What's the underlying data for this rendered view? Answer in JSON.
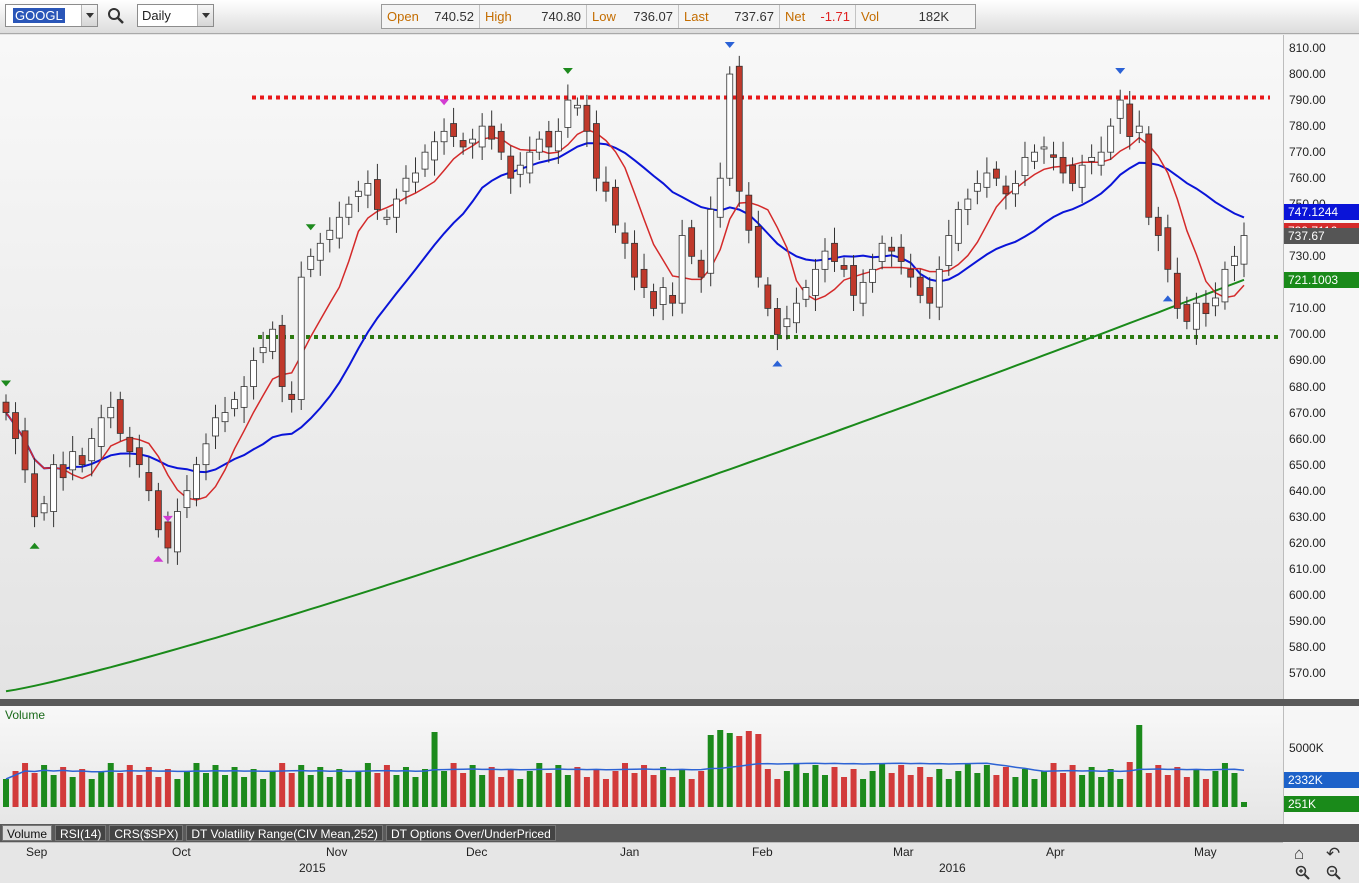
{
  "toolbar": {
    "symbol": "GOOGL",
    "interval": "Daily",
    "quote": [
      {
        "label": "Open",
        "value": "740.52",
        "color": "#333333"
      },
      {
        "label": "High",
        "value": "740.80",
        "color": "#333333"
      },
      {
        "label": "Low",
        "value": "736.07",
        "color": "#333333"
      },
      {
        "label": "Last",
        "value": "737.67",
        "color": "#333333"
      },
      {
        "label": "Net",
        "value": "-1.71",
        "color": "#e02020"
      },
      {
        "label": "Vol",
        "value": "182K",
        "color": "#333333"
      }
    ]
  },
  "price_axis": {
    "ticks": [
      "810.00",
      "800.00",
      "790.00",
      "780.00",
      "770.00",
      "760.00",
      "750.00",
      "740.00",
      "730.00",
      "720.00",
      "710.00",
      "700.00",
      "690.00",
      "680.00",
      "670.00",
      "660.00",
      "650.00",
      "640.00",
      "630.00",
      "620.00",
      "610.00",
      "600.00",
      "590.00",
      "580.00",
      "570.00"
    ],
    "tags": [
      {
        "text": "747.1244",
        "color": "#0a14d8",
        "value": 747.12
      },
      {
        "text": "739.7116",
        "color": "#d42a2a",
        "value": 739.71
      },
      {
        "text": "737.67",
        "color": "#555555",
        "value": 737.67
      },
      {
        "text": "721.1003",
        "color": "#1a8a1a",
        "value": 721.1
      }
    ]
  },
  "volume": {
    "title": "Volume",
    "tags": [
      {
        "text": "5000K",
        "kind": "tick"
      },
      {
        "text": "2332K",
        "color": "#1d62c9"
      },
      {
        "text": "251K",
        "color": "#1a8a1a"
      }
    ]
  },
  "tabs": [
    "Volume",
    "RSI(14)",
    "CRS($SPX)",
    "DT Volatility Range(CIV Mean,252)",
    "DT Options Over/UnderPriced"
  ],
  "date_axis": {
    "months": [
      "Sep",
      "Oct",
      "Nov",
      "Dec",
      "Jan",
      "Feb",
      "Mar",
      "Apr",
      "May"
    ],
    "years": [
      "2015",
      "2016"
    ]
  },
  "nav_icons": [
    "home-icon",
    "undo-icon",
    "zoom-in-icon",
    "zoom-out-icon"
  ],
  "chart_data": {
    "type": "candlestick",
    "symbol": "GOOGL",
    "interval": "Daily",
    "ylim": [
      560,
      815
    ],
    "resistance": 791,
    "support": 699,
    "up_color": "#ffffff",
    "down_color": "#c0392b",
    "sma_colors": {
      "short": "#d42a2a",
      "mid": "#0a14d8",
      "long": "#1a8a1a"
    },
    "x_months": [
      "Sep",
      "Oct",
      "Nov",
      "Dec",
      "Jan",
      "Feb",
      "Mar",
      "Apr",
      "May"
    ],
    "closes": [
      670,
      660,
      648,
      630,
      635,
      650,
      645,
      655,
      650,
      660,
      668,
      672,
      662,
      655,
      650,
      640,
      625,
      618,
      632,
      640,
      650,
      658,
      668,
      670,
      675,
      680,
      690,
      695,
      702,
      680,
      675,
      722,
      730,
      735,
      740,
      745,
      750,
      755,
      758,
      748,
      745,
      752,
      760,
      762,
      770,
      774,
      778,
      776,
      772,
      775,
      780,
      775,
      770,
      760,
      765,
      770,
      775,
      772,
      778,
      790,
      788,
      778,
      760,
      755,
      742,
      735,
      722,
      718,
      710,
      718,
      712,
      738,
      730,
      722,
      748,
      760,
      800,
      755,
      740,
      722,
      710,
      700,
      706,
      712,
      718,
      725,
      732,
      728,
      725,
      715,
      720,
      725,
      735,
      732,
      728,
      722,
      715,
      712,
      725,
      738,
      748,
      752,
      758,
      762,
      760,
      754,
      758,
      768,
      770,
      772,
      768,
      762,
      758,
      765,
      768,
      770,
      780,
      790,
      776,
      780,
      745,
      738,
      725,
      710,
      705,
      712,
      708,
      714,
      725,
      730,
      738
    ]
  }
}
